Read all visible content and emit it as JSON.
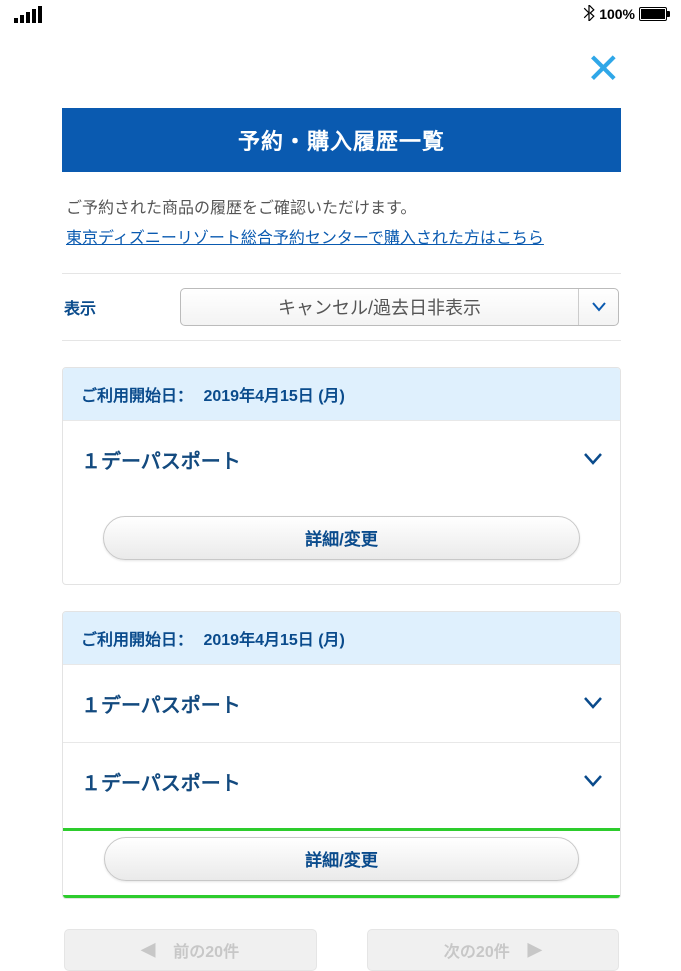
{
  "status": {
    "battery_text": "100%"
  },
  "close_glyph": "✕",
  "title": "予約・購入履歴一覧",
  "intro": {
    "text": "ご予約された商品の履歴をご確認いただけます。",
    "link": "東京ディズニーリゾート総合予約センターで購入された方はこちら"
  },
  "filter": {
    "label": "表示",
    "selected": "キャンセル/過去日非表示"
  },
  "cards": [
    {
      "date_label": "ご利用開始日：",
      "date_value": "2019年4月15日 (月)",
      "items": [
        {
          "name": "１デーパスポート"
        }
      ],
      "action": "詳細/変更"
    },
    {
      "date_label": "ご利用開始日：",
      "date_value": "2019年4月15日 (月)",
      "items": [
        {
          "name": "１デーパスポート"
        },
        {
          "name": "１デーパスポート"
        }
      ],
      "action": "詳細/変更"
    }
  ],
  "pager": {
    "prev": "前の20件",
    "next": "次の20件"
  }
}
